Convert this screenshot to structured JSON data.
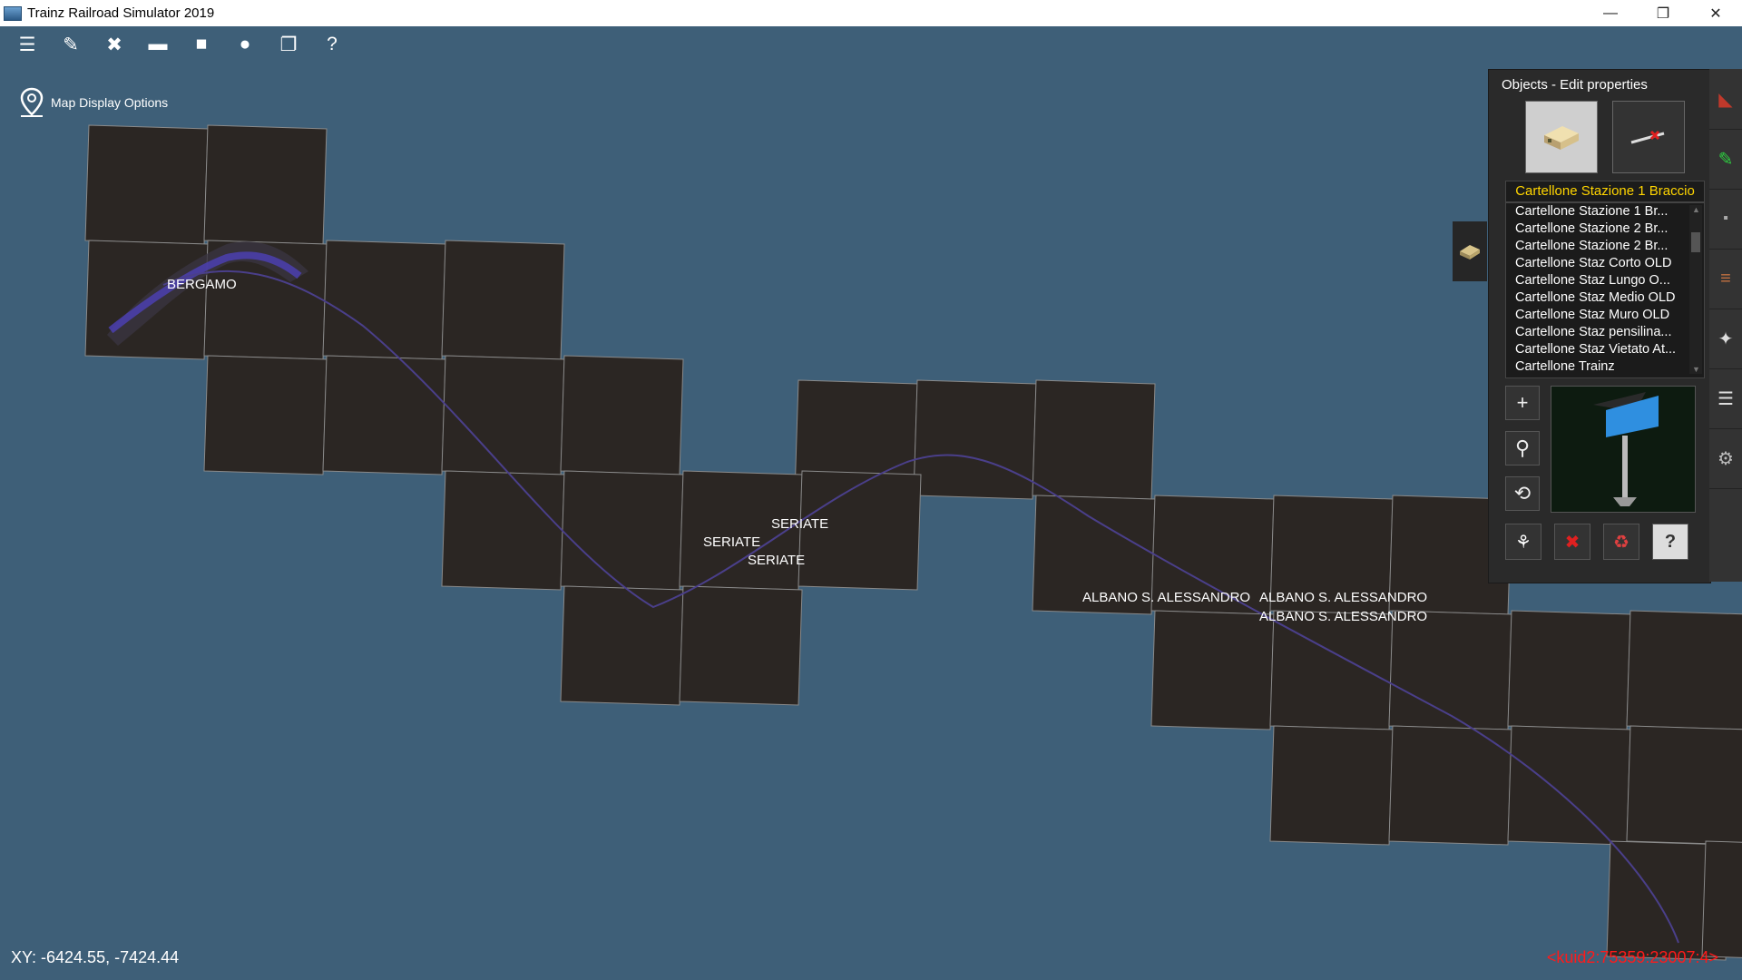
{
  "window": {
    "title": "Trainz Railroad Simulator 2019",
    "controls": {
      "minimize": "—",
      "restore": "❐",
      "close": "✕"
    }
  },
  "toolbar": [
    {
      "name": "menu-icon",
      "glyph": "☰"
    },
    {
      "name": "edit-icon",
      "glyph": "✎"
    },
    {
      "name": "tools-icon",
      "glyph": "✖"
    },
    {
      "name": "display-icon",
      "glyph": "▬"
    },
    {
      "name": "camera-icon",
      "glyph": "■"
    },
    {
      "name": "chat-icon",
      "glyph": "●"
    },
    {
      "name": "window-icon",
      "glyph": "❐"
    },
    {
      "name": "help-icon",
      "glyph": "?"
    }
  ],
  "map_options": {
    "label": "Map Display Options"
  },
  "stations": {
    "bergamo": "BERGAMO",
    "seriate_1": "SERIATE",
    "seriate_2": "SERIATE",
    "seriate_3": "SERIATE",
    "albano_1": "ALBANO S. ALESSANDRO",
    "albano_2": "ALBANO S. ALESSANDRO",
    "albano_3": "ALBANO S. ALESSANDRO"
  },
  "status": {
    "coords": "XY: -6424.55, -7424.44",
    "kuid": "<kuid2:75359:23007:4>"
  },
  "panel": {
    "title": "Objects - Edit properties",
    "selected": "Cartellone Stazione 1 Braccio",
    "items": [
      "Cartellone Stazione 1 Br...",
      "Cartellone Stazione 2 Br...",
      "Cartellone Stazione 2 Br...",
      "Cartellone Staz Corto OLD",
      "Cartellone Staz Lungo O...",
      "Cartellone Staz Medio OLD",
      "Cartellone Staz Muro OLD",
      "Cartellone Staz pensilina...",
      "Cartellone Staz Vietato At...",
      "Cartellone Trainz"
    ],
    "side_tools": [
      "+",
      "⚲",
      "⟲"
    ],
    "bottom_tools": [
      "⚘",
      "✖",
      "♻",
      "?"
    ]
  },
  "colors": {
    "water": "#3e5f78",
    "tile": "#2b2623",
    "tile_grid": "#8a8a8a",
    "track": "#4a3f8a",
    "selected_text": "#ffd500",
    "kuid_text": "#ff1a1a"
  }
}
